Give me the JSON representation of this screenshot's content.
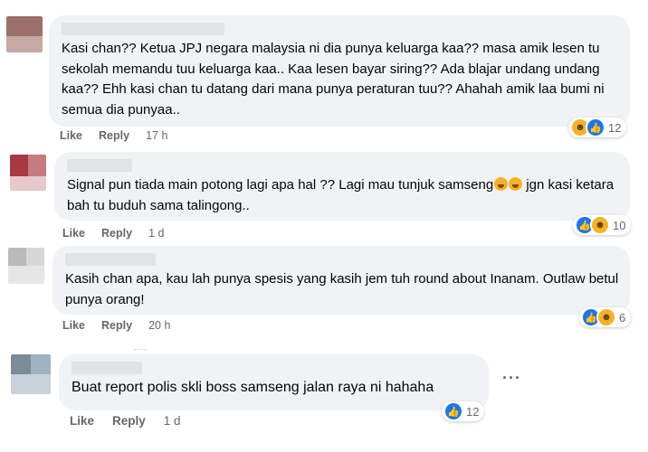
{
  "comments": [
    {
      "text": "Kasi chan?? Ketua JPJ negara malaysia ni dia punya keluarga kaa?? masa amik lesen tu sekolah memandu tuu keluarga kaa.. Kaa lesen bayar siring?? Ada blajar undang undang kaa?? Ehh kasi chan tu datang dari mana punya peraturan tuu?? Ahahah amik laa bumi ni semua dia punyaa..",
      "like": "Like",
      "reply": "Reply",
      "time": "17 h",
      "reaction_icons": [
        "haha-icon",
        "like-icon"
      ],
      "reaction_count": "12"
    },
    {
      "text": "Signal pun tiada main potong lagi apa hal ?? Lagi mau tunjuk samseng",
      "text_after": " jgn kasi ketara bah tu buduh sama talingong..",
      "like": "Like",
      "reply": "Reply",
      "time": "1 d",
      "reaction_icons": [
        "like-icon",
        "haha-icon"
      ],
      "reaction_count": "10"
    },
    {
      "text": "Kasih chan apa, kau lah punya spesis yang kasih jem tuh round about Inanam. Outlaw betul punya orang!",
      "like": "Like",
      "reply": "Reply",
      "time": "20 h",
      "reaction_icons": [
        "like-icon",
        "haha-icon"
      ],
      "reaction_count": "6"
    },
    {
      "text": "Buat report polis skli boss samseng jalan raya ni hahaha",
      "like": "Like",
      "reply": "Reply",
      "time": "1 d",
      "reaction_icons": [
        "like-icon"
      ],
      "reaction_count": "12",
      "more": "···"
    }
  ],
  "colors": {
    "bubble": "#f0f2f5",
    "like_blue": "#1877f2",
    "haha_yellow": "#f7b125",
    "meta_gray": "#65676b"
  }
}
